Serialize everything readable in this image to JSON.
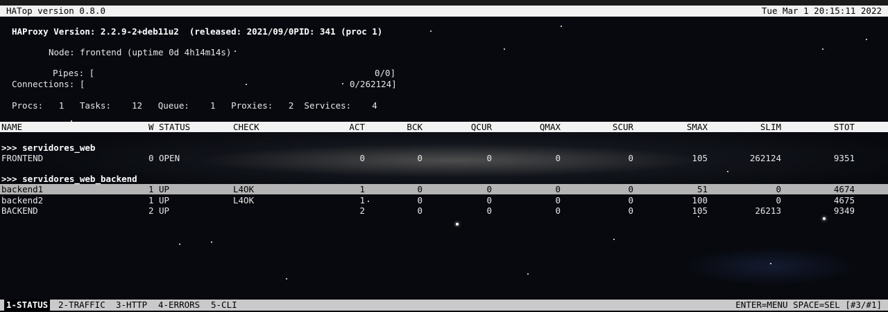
{
  "top_bar": {
    "title": "HATop version 0.8.0",
    "datetime": "Tue Mar  1 20:15:11 2022"
  },
  "info": {
    "version_line": "HAProxy Version: 2.2.9-2+deb11u2  (released: 2021/09/0PID: 341 (proc 1)",
    "node_line": "Node: frontend (uptime 0d 4h14m14s)",
    "pipes_label": "Pipes: [",
    "pipes_value": "0/0]",
    "connections_label": "Connections: [",
    "connections_value": "0/262124]",
    "stats_line": "Procs:   1   Tasks:    12   Queue:    1   Proxies:   2  Services:    4"
  },
  "columns": {
    "name": "NAME",
    "w": "W",
    "status": "STATUS",
    "check": "CHECK",
    "act": "ACT",
    "bck": "BCK",
    "qcur": "QCUR",
    "qmax": "QMAX",
    "scur": "SCUR",
    "smax": "SMAX",
    "slim": "SLIM",
    "stot": "STOT"
  },
  "groups": [
    {
      "title": ">>> servidores_web",
      "rows": [
        {
          "name": "FRONTEND",
          "w": "0",
          "status": "OPEN",
          "check": "",
          "act": "0",
          "bck": "0",
          "qcur": "0",
          "qmax": "0",
          "scur": "0",
          "smax": "105",
          "slim": "262124",
          "stot": "9351"
        }
      ]
    },
    {
      "title": ">>> servidores_web_backend",
      "rows": [
        {
          "name": "backend1",
          "w": "1",
          "status": "UP",
          "check": "L4OK",
          "act": "1",
          "bck": "0",
          "qcur": "0",
          "qmax": "0",
          "scur": "0",
          "smax": "51",
          "slim": "0",
          "stot": "4674"
        },
        {
          "name": "backend2",
          "w": "1",
          "status": "UP",
          "check": "L4OK",
          "act": "1",
          "bck": "0",
          "qcur": "0",
          "qmax": "0",
          "scur": "0",
          "smax": "100",
          "slim": "0",
          "stot": "4675"
        },
        {
          "name": "BACKEND",
          "w": "2",
          "status": "UP",
          "check": "",
          "act": "2",
          "bck": "0",
          "qcur": "0",
          "qmax": "0",
          "scur": "0",
          "smax": "105",
          "slim": "26213",
          "stot": "9349"
        }
      ]
    }
  ],
  "bottom_bar": {
    "tabs": [
      "1-STATUS",
      "2-TRAFFIC",
      "3-HTTP",
      "4-ERRORS",
      "5-CLI"
    ],
    "active_tab": "1-STATUS",
    "hint": "ENTER=MENU SPACE=SEL [#3/#1]"
  }
}
